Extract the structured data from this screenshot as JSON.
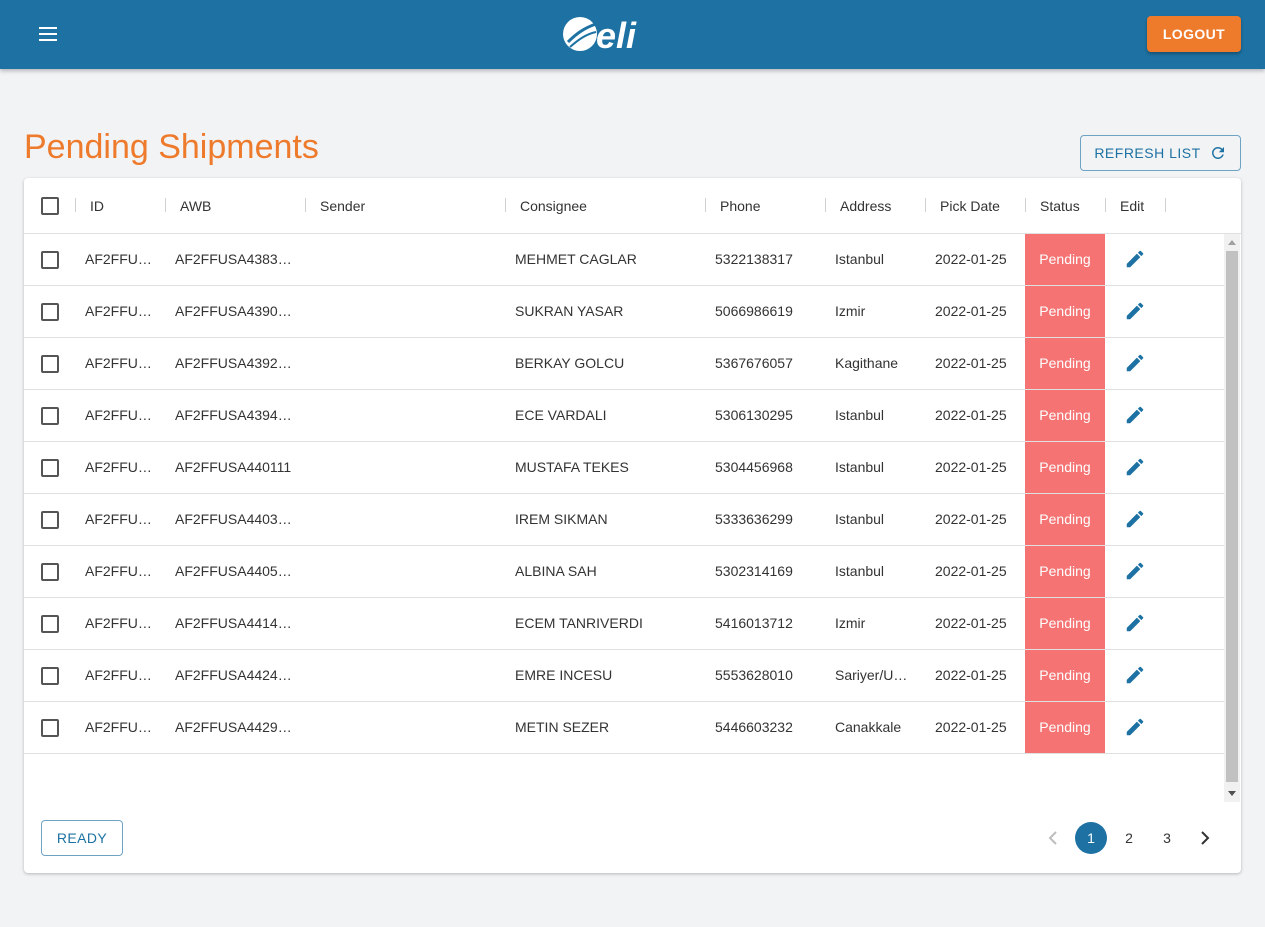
{
  "header": {
    "logo_text": "Celi",
    "logout_label": "LOGOUT"
  },
  "page": {
    "title": "Pending Shipments",
    "refresh_label": "REFRESH LIST"
  },
  "table": {
    "columns": [
      "ID",
      "AWB",
      "Sender",
      "Consignee",
      "Phone",
      "Address",
      "Pick Date",
      "Status",
      "Edit"
    ],
    "rows": [
      {
        "id": "AF2FFU…",
        "awb": "AF2FFUSA4383…",
        "sender": "",
        "consignee": "MEHMET CAGLAR",
        "phone": "5322138317",
        "address": "Istanbul",
        "pick_date": "2022-01-25",
        "status": "Pending"
      },
      {
        "id": "AF2FFU…",
        "awb": "AF2FFUSA4390…",
        "sender": "",
        "consignee": "SUKRAN YASAR",
        "phone": "5066986619",
        "address": "Izmir",
        "pick_date": "2022-01-25",
        "status": "Pending"
      },
      {
        "id": "AF2FFU…",
        "awb": "AF2FFUSA4392…",
        "sender": "",
        "consignee": "BERKAY GOLCU",
        "phone": "5367676057",
        "address": "Kagithane",
        "pick_date": "2022-01-25",
        "status": "Pending"
      },
      {
        "id": "AF2FFU…",
        "awb": "AF2FFUSA4394…",
        "sender": "",
        "consignee": "ECE VARDALI",
        "phone": "5306130295",
        "address": "Istanbul",
        "pick_date": "2022-01-25",
        "status": "Pending"
      },
      {
        "id": "AF2FFU…",
        "awb": "AF2FFUSA440111",
        "sender": "",
        "consignee": "MUSTAFA TEKES",
        "phone": "5304456968",
        "address": "Istanbul",
        "pick_date": "2022-01-25",
        "status": "Pending"
      },
      {
        "id": "AF2FFU…",
        "awb": "AF2FFUSA4403…",
        "sender": "",
        "consignee": "IREM SIKMAN",
        "phone": "5333636299",
        "address": "Istanbul",
        "pick_date": "2022-01-25",
        "status": "Pending"
      },
      {
        "id": "AF2FFU…",
        "awb": "AF2FFUSA4405…",
        "sender": "",
        "consignee": "ALBINA SAH",
        "phone": "5302314169",
        "address": "Istanbul",
        "pick_date": "2022-01-25",
        "status": "Pending"
      },
      {
        "id": "AF2FFU…",
        "awb": "AF2FFUSA4414…",
        "sender": "",
        "consignee": "ECEM TANRIVERDI",
        "phone": "5416013712",
        "address": "Izmir",
        "pick_date": "2022-01-25",
        "status": "Pending"
      },
      {
        "id": "AF2FFU…",
        "awb": "AF2FFUSA4424…",
        "sender": "",
        "consignee": "EMRE INCESU",
        "phone": "5553628010",
        "address": "Sariyer/U…",
        "pick_date": "2022-01-25",
        "status": "Pending"
      },
      {
        "id": "AF2FFU…",
        "awb": "AF2FFUSA4429…",
        "sender": "",
        "consignee": "METIN SEZER",
        "phone": "5446603232",
        "address": "Canakkale",
        "pick_date": "2022-01-25",
        "status": "Pending"
      }
    ]
  },
  "footer": {
    "ready_label": "READY",
    "pages": [
      "1",
      "2",
      "3"
    ],
    "current_page": "1"
  },
  "colors": {
    "header_bg": "#1d72a3",
    "accent_orange": "#ee7a2c",
    "status_pending_bg": "#f57373"
  },
  "icons": {
    "menu": "menu-icon",
    "refresh": "refresh-icon",
    "edit": "pencil-icon",
    "prev": "chevron-left-icon",
    "next": "chevron-right-icon"
  }
}
